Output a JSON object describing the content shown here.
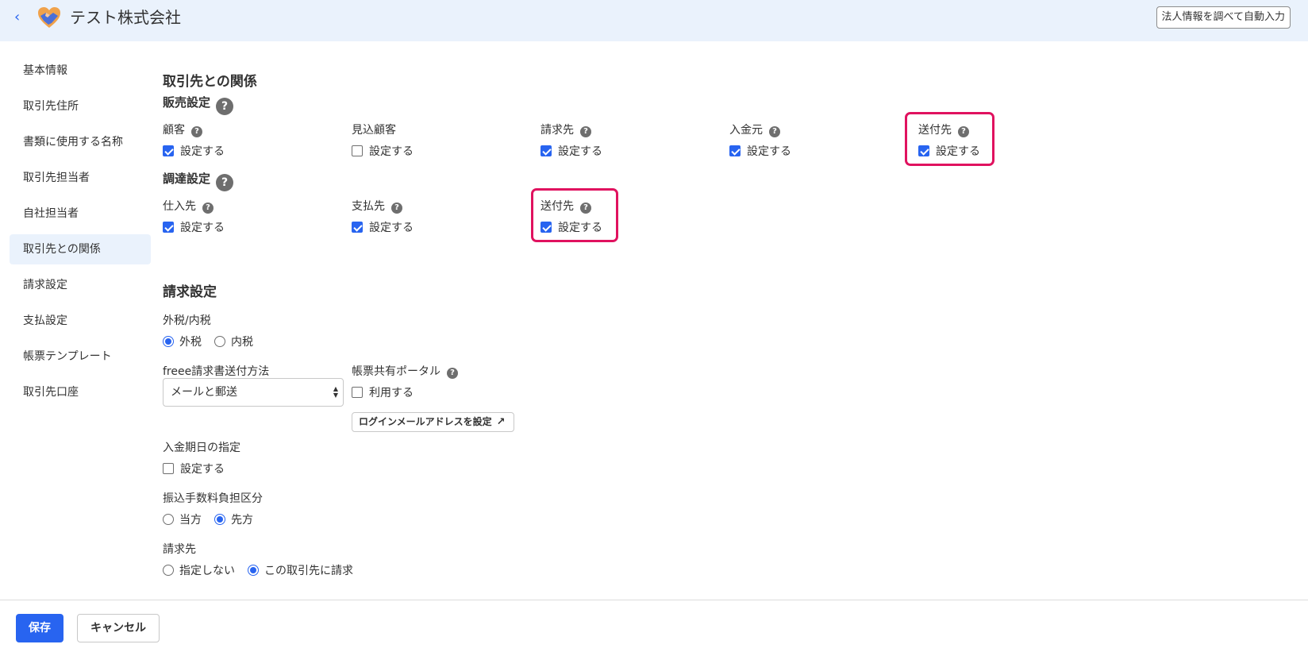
{
  "header": {
    "title": "テスト株式会社",
    "auto_fill_button": "法人情報を調べて自動入力"
  },
  "sidebar": {
    "items": [
      {
        "label": "基本情報"
      },
      {
        "label": "取引先住所"
      },
      {
        "label": "書類に使用する名称"
      },
      {
        "label": "取引先担当者"
      },
      {
        "label": "自社担当者"
      },
      {
        "label": "取引先との関係",
        "active": true
      },
      {
        "label": "請求設定"
      },
      {
        "label": "支払設定"
      },
      {
        "label": "帳票テンプレート"
      },
      {
        "label": "取引先口座"
      }
    ]
  },
  "relation": {
    "title": "取引先との関係",
    "sales": {
      "title": "販売設定",
      "fields": [
        {
          "label": "顧客",
          "has_help": true,
          "option": "設定する",
          "checked": true
        },
        {
          "label": "見込顧客",
          "has_help": false,
          "option": "設定する",
          "checked": false
        },
        {
          "label": "請求先",
          "has_help": true,
          "option": "設定する",
          "checked": true
        },
        {
          "label": "入金元",
          "has_help": true,
          "option": "設定する",
          "checked": true
        },
        {
          "label": "送付先",
          "has_help": true,
          "option": "設定する",
          "checked": true,
          "highlighted": true
        }
      ]
    },
    "procurement": {
      "title": "調達設定",
      "fields": [
        {
          "label": "仕入先",
          "has_help": true,
          "option": "設定する",
          "checked": true
        },
        {
          "label": "支払先",
          "has_help": true,
          "option": "設定する",
          "checked": true
        },
        {
          "label": "送付先",
          "has_help": true,
          "option": "設定する",
          "checked": true,
          "highlighted": true
        }
      ]
    }
  },
  "billing": {
    "title": "請求設定",
    "tax": {
      "label": "外税/内税",
      "options": [
        "外税",
        "内税"
      ],
      "selected": "外税"
    },
    "send_method": {
      "label": "freee請求書送付方法",
      "value": "メールと郵送"
    },
    "portal": {
      "label": "帳票共有ポータル",
      "option": "利用する",
      "checked": false,
      "button": "ログインメールアドレスを設定"
    },
    "due_date": {
      "label": "入金期日の指定",
      "option": "設定する",
      "checked": false
    },
    "fee": {
      "label": "振込手数料負担区分",
      "options": [
        "当方",
        "先方"
      ],
      "selected": "先方"
    },
    "bill_to": {
      "label": "請求先",
      "options": [
        "指定しない",
        "この取引先に請求"
      ],
      "selected": "この取引先に請求"
    }
  },
  "footer": {
    "save": "保存",
    "cancel": "キャンセル"
  },
  "colors": {
    "accent": "#2864f0",
    "highlight": "#e0125f",
    "header_bg": "#eaf2fc"
  }
}
